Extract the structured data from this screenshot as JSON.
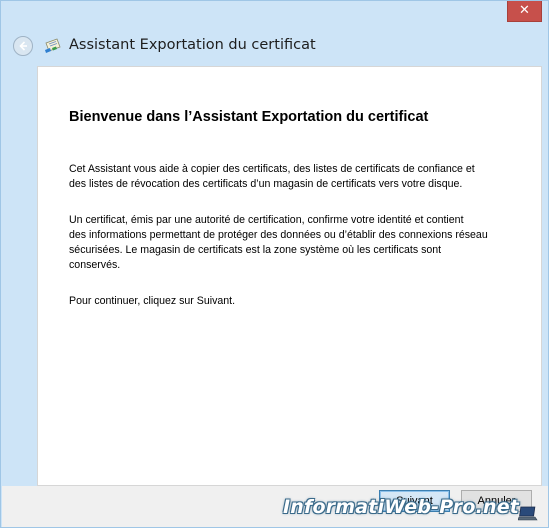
{
  "window": {
    "close_glyph": "✕"
  },
  "titlebar": {
    "title": "Assistant Exportation du certificat",
    "back_icon": "back-arrow-icon",
    "app_icon": "certificate-icon"
  },
  "content": {
    "heading": "Bienvenue dans l’Assistant Exportation du certificat",
    "paragraphs": [
      "Cet Assistant vous aide à copier des certificats, des listes de certificats de confiance et\ndes listes de révocation des certificats d’un magasin de certificats vers votre disque.",
      "Un certificat, émis par une autorité de certification, confirme votre identité et contient\ndes informations permettant de protéger des données ou d’établir des connexions réseau\nsécurisées. Le magasin de certificats est la zone système où les certificats sont\nconservés.",
      "Pour continuer, cliquez sur Suivant."
    ]
  },
  "footer": {
    "next_label": "Suivant",
    "cancel_label": "Annuler"
  },
  "watermark": {
    "text": "InformatiWeb-Pro.net"
  },
  "colors": {
    "frame": "#cde4f7",
    "close_button": "#c7504b",
    "primary_button_border": "#3c7fb1"
  }
}
